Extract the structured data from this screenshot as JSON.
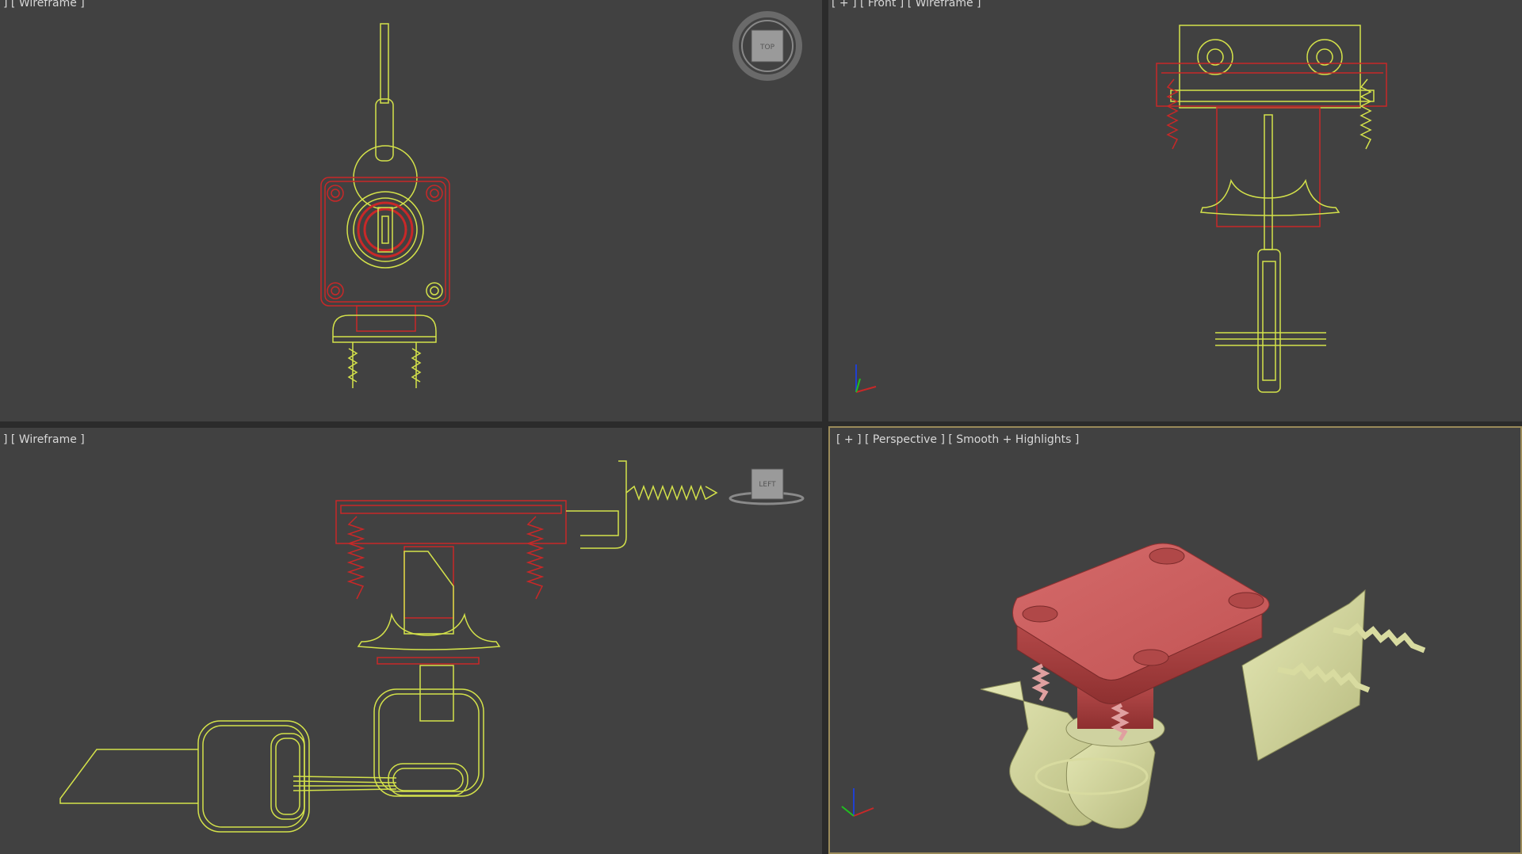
{
  "viewports": {
    "top_left": {
      "label": "] [ Wireframe ]",
      "navcube": "TOP"
    },
    "top_right": {
      "label": "[ + ] [ Front ] [ Wireframe ]"
    },
    "bottom_left": {
      "label": "] [ Wireframe ]",
      "navcube": "LEFT"
    },
    "bottom_right": {
      "label": "[ + ] [ Perspective ] [ Smooth + Highlights ]"
    }
  },
  "colors": {
    "viewport_bg": "#414141",
    "wire_yellow": "#d4e24a",
    "wire_red": "#c82828",
    "plate_red": "#c85a5a",
    "bracket_cream": "#d8dba0",
    "active_border": "#9a8a5a"
  },
  "icons": [
    "viewcube-top-icon",
    "viewcube-left-icon",
    "axis-tripod-icon"
  ]
}
